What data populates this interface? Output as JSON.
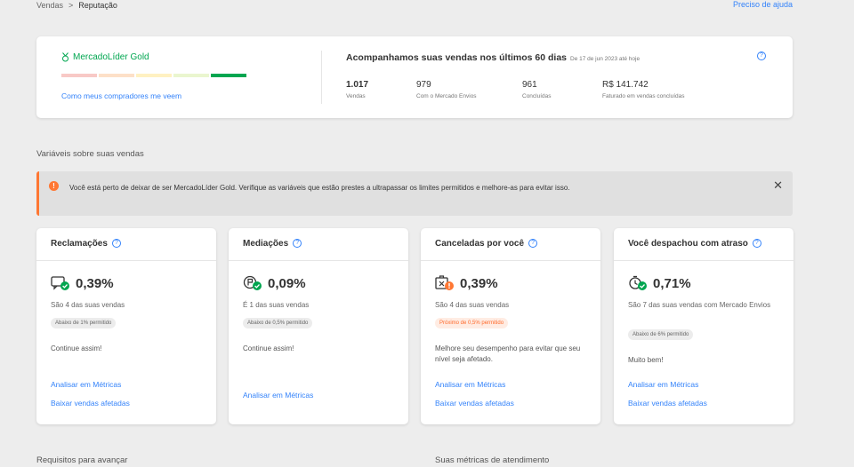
{
  "breadcrumb": {
    "parent": "Vendas",
    "separator": ">",
    "current": "Reputação"
  },
  "help_link": "Preciso de ajuda",
  "summary": {
    "level": "MercadoLíder Gold",
    "thermometer_colors": [
      "#f8c9c6",
      "#fde0c8",
      "#fff1c2",
      "#eaf6cf",
      "#00a650"
    ],
    "buyer_view_link": "Como meus compradores me veem",
    "period_title": "Acompanhamos suas vendas nos últimos 60 dias",
    "period_range": "De 17 de jun 2023 até hoje",
    "stats": [
      {
        "value": "1.017",
        "label": "Vendas"
      },
      {
        "value": "979",
        "label": "Com o Mercado Envios"
      },
      {
        "value": "961",
        "label": "Concluídas"
      },
      {
        "value": "R$ 141.742",
        "label": "Faturado em vendas concluídas"
      }
    ]
  },
  "variables_title": "Variáveis sobre suas vendas",
  "alert": {
    "icon": "!",
    "text": "Você está perto de deixar de ser MercadoLíder Gold. Verifique as variáveis que estão prestes a ultrapassar os limites permitidos e melhore-as para evitar isso.",
    "close": "✕"
  },
  "cards": [
    {
      "title": "Reclamações",
      "value": "0,39%",
      "description": "São 4 das suas vendas",
      "badge": "Abaixo de 1% permitido",
      "advice": "Continue assim!",
      "link1": "Analisar em Métricas",
      "link2": "Baixar vendas afetadas"
    },
    {
      "title": "Mediações",
      "value": "0,09%",
      "description": "É 1 das suas vendas",
      "badge": "Abaixo de 0,5% permitido",
      "advice": "Continue assim!",
      "link1": "Analisar em Métricas"
    },
    {
      "title": "Canceladas por você",
      "value": "0,39%",
      "description": "São 4 das suas vendas",
      "badge": "Próximo de 0,5% permitido",
      "advice": "Melhore seu desempenho para evitar que seu nível seja afetado.",
      "link1": "Analisar em Métricas",
      "link2": "Baixar vendas afetadas"
    },
    {
      "title": "Você despachou com atraso",
      "value": "0,71%",
      "description": "São 7 das suas vendas com Mercado Envios",
      "badge": "Abaixo de 6% permitido",
      "advice": "Muito bem!",
      "link1": "Analisar em Métricas",
      "link2": "Baixar vendas afetadas"
    }
  ],
  "requirements_title": "Requisitos para avançar",
  "service_metrics_title": "Suas métricas de atendimento",
  "colors": {
    "accent": "#3483fa",
    "success": "#00a650",
    "warning": "#ff7733"
  }
}
